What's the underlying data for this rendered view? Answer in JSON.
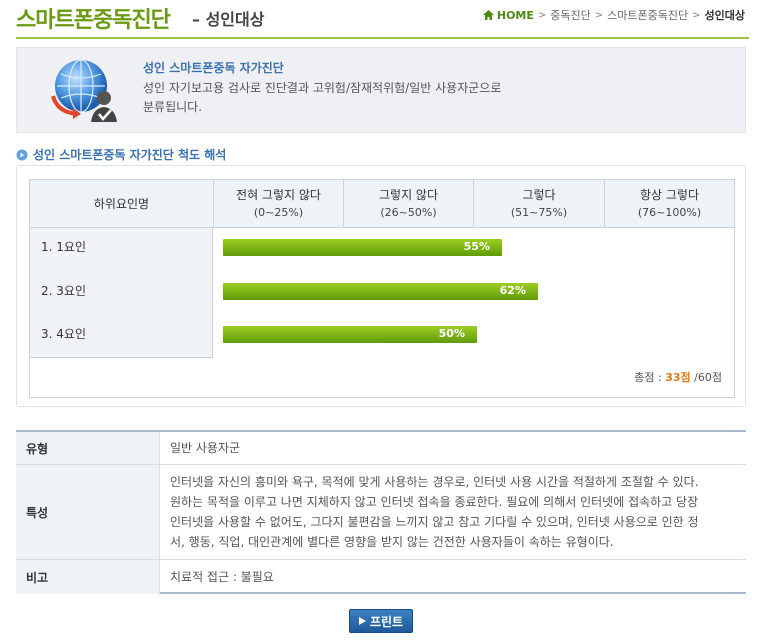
{
  "header": {
    "title": "스마트폰중독진단",
    "subtitle": "– 성인대상",
    "breadcrumb": {
      "home": "HOME",
      "items": [
        "중독진단",
        "스마트폰중독진단"
      ],
      "current": "성인대상"
    }
  },
  "intro": {
    "title": "성인 스마트폰중독 자가진단",
    "line1": "성인 자기보고용 검사로 진단결과 고위험/잠재적위험/일반 사용자군으로",
    "line2": "분류됩니다."
  },
  "section": {
    "title": "성인 스마트폰중독 자가진단 척도 해석"
  },
  "score_table": {
    "col_factor": "하위요인명",
    "columns": [
      {
        "label": "전혀 그렇지 않다",
        "range": "(0~25%)"
      },
      {
        "label": "그렇지 않다",
        "range": "(26~50%)"
      },
      {
        "label": "그렇다",
        "range": "(51~75%)"
      },
      {
        "label": "항상 그렇다",
        "range": "(76~100%)"
      }
    ],
    "rows": [
      {
        "label": "1. 1요인",
        "percent": 55,
        "percent_text": "55%"
      },
      {
        "label": "2. 3요인",
        "percent": 62,
        "percent_text": "62%"
      },
      {
        "label": "3. 4요인",
        "percent": 50,
        "percent_text": "50%"
      }
    ],
    "total": {
      "label": "총점 :",
      "score": "33점",
      "max": "/60점"
    }
  },
  "result": {
    "type_label": "유형",
    "type_value": "일반 사용자군",
    "trait_label": "특성",
    "trait_lines": [
      "인터넷을 자신의 흥미와 욕구, 목적에 맞게 사용하는 경우로, 인터넷 사용 시간을 적절하게 조절할 수 있다.",
      "원하는 목적을 이루고 나면 지체하지 않고 인터넷 접속을 종료한다. 필요에 의해서 인터넷에 접속하고 당장",
      "인터넷을 사용할 수 없어도, 그다지 불편감을 느끼지 않고 참고 기다릴 수 있으며, 인터넷 사용으로 인한 정",
      "서, 행동, 직업, 대인관계에 별다른 영향을 받지 않는 건전한 사용자들이 속하는 유형이다."
    ],
    "note_label": "비고",
    "note_value": "치료적 접근 : 불필요"
  },
  "print_button": {
    "label": "프린트"
  },
  "colors": {
    "title_green": "#6a9a12",
    "link_blue": "#3a72b0",
    "bar_green": "#7bb416",
    "score_orange": "#e07a10",
    "button_blue": "#2a6aab"
  }
}
